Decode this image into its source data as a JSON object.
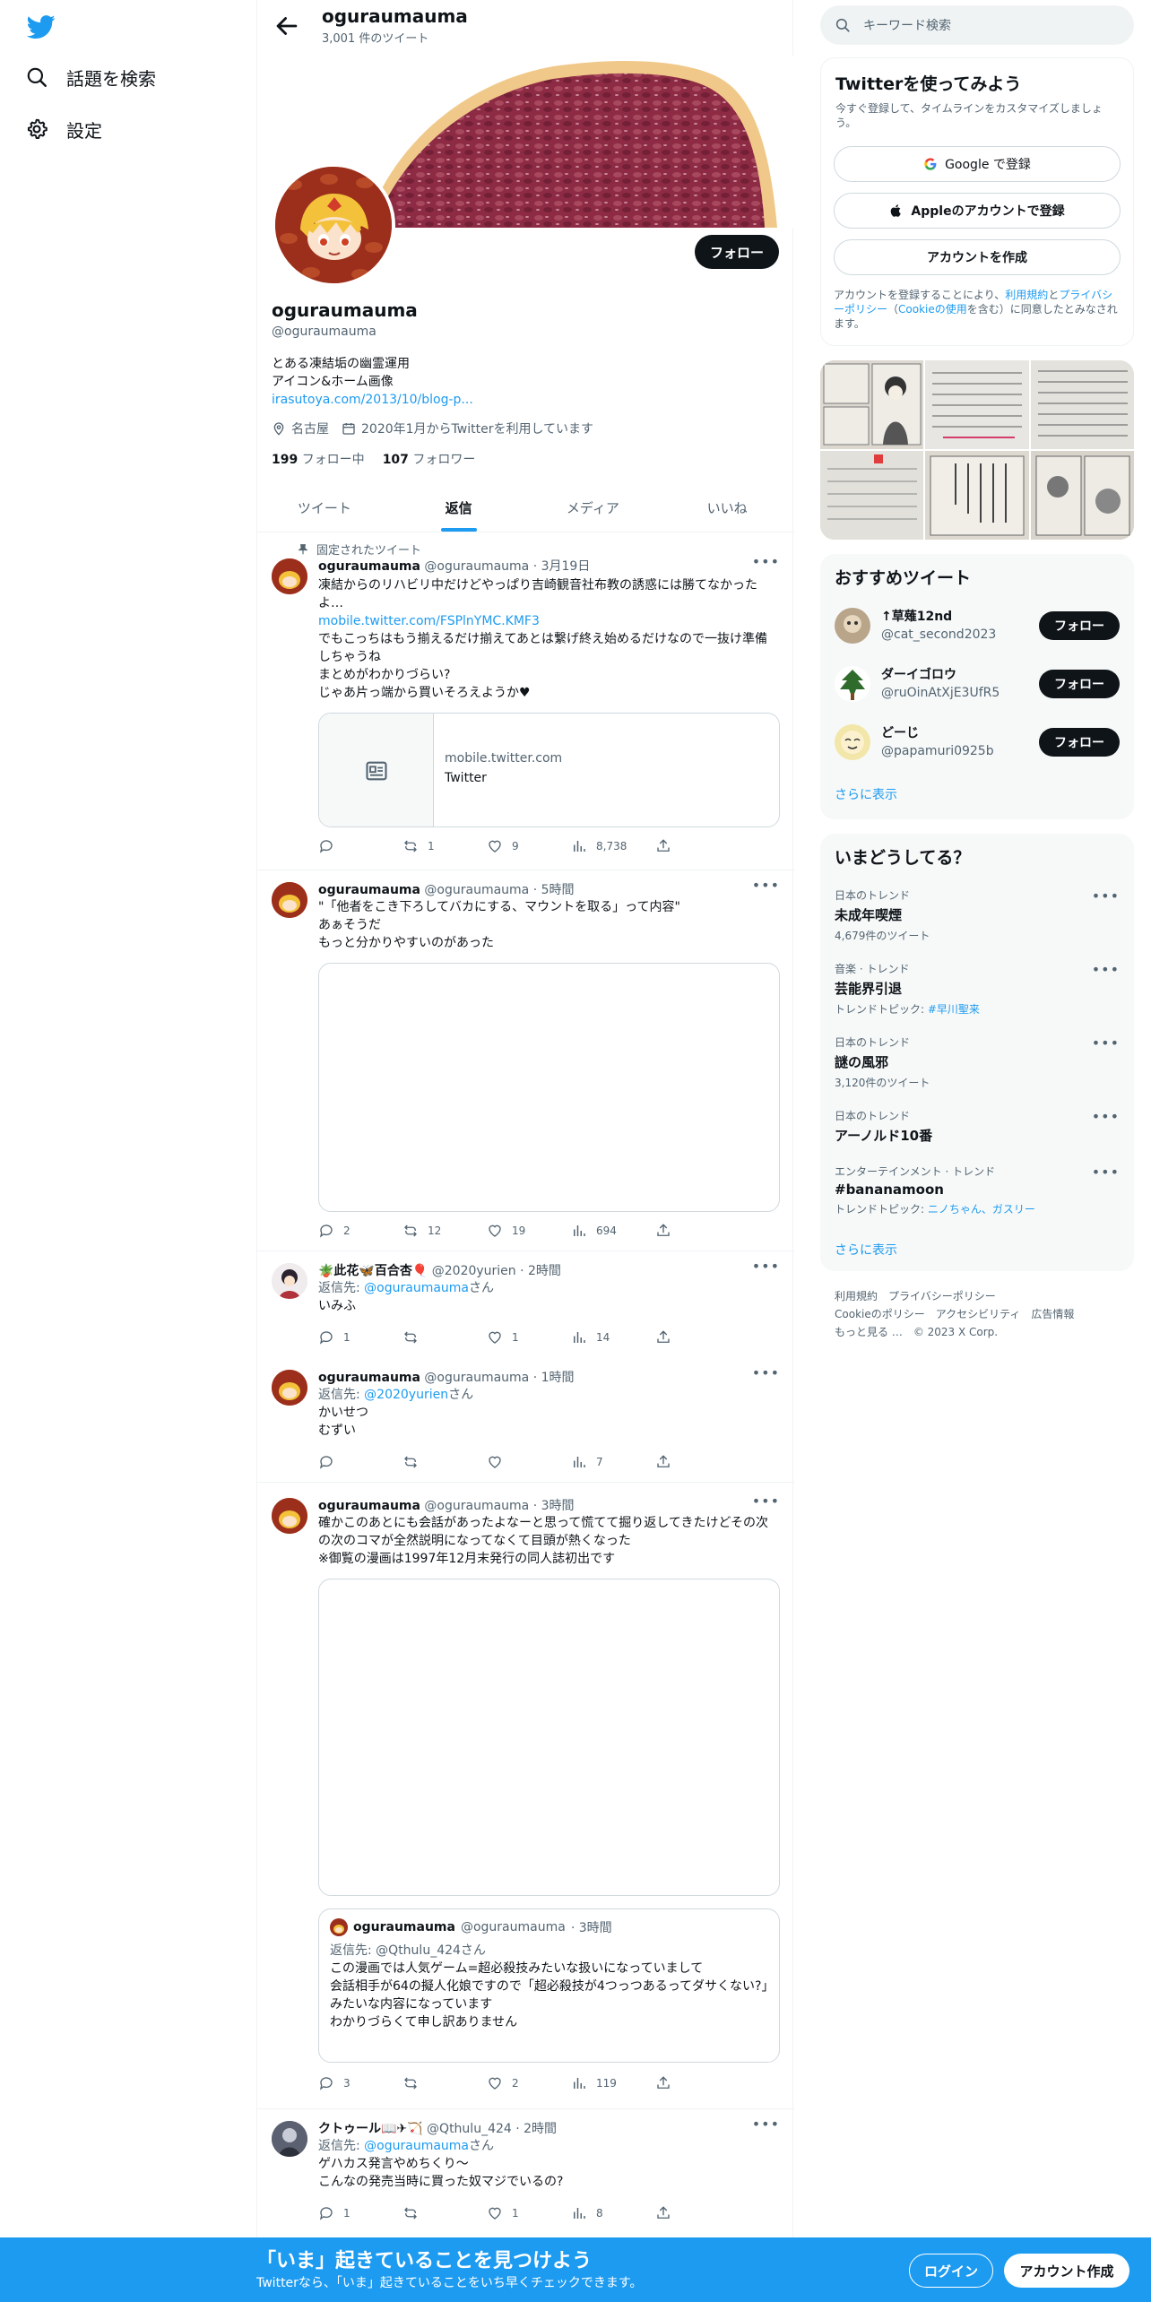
{
  "nav": {
    "explore_label": "話題を検索",
    "settings_label": "設定"
  },
  "header": {
    "name": "oguraumauma",
    "tweet_count": "3,001 件のツイート"
  },
  "profile": {
    "follow_label": "フォロー",
    "name": "oguraumauma",
    "handle": "@oguraumauma",
    "bio_line1": "とある凍結垢の幽霊運用",
    "bio_line2": "アイコン&ホーム画像",
    "bio_link": "irasutoya.com/2013/10/blog-p...",
    "location": "名古屋",
    "joined": "2020年1月からTwitterを利用しています",
    "following_count": "199",
    "following_label": "フォロー中",
    "followers_count": "107",
    "followers_label": "フォロワー"
  },
  "tabs": [
    {
      "label": "ツイート"
    },
    {
      "label": "返信"
    },
    {
      "label": "メディア"
    },
    {
      "label": "いいね"
    }
  ],
  "tweets": [
    {
      "pinned_label": "固定されたツイート",
      "name": "oguraumauma",
      "handle": "@oguraumauma",
      "time": "· 3月19日",
      "line1": "凍結からのリハビリ中だけどやっぱり吉崎観音社布教の誘惑には勝てなかったよ…",
      "link": "mobile.twitter.com/FSPlnYMC.KMF3",
      "line2": "でもこっちはもう揃えるだけ揃えてあとは繋げ終え始めるだけなので一抜け準備しちゃうね",
      "line3": "まとめがわかりづらい?",
      "line4": "じゃあ片っ端から買いそろえようか♥",
      "card_domain": "mobile.twitter.com",
      "card_title": "Twitter",
      "replies": "",
      "retweets": "1",
      "likes": "9",
      "views": "8,738"
    },
    {
      "name": "oguraumauma",
      "handle": "@oguraumauma",
      "time": "· 5時間",
      "line1": "\"「他者をこき下ろしてバカにする、マウントを取る」って内容\"",
      "line2": "あぁそうだ",
      "line3": "もっと分かりやすいのがあった",
      "replies": "2",
      "retweets": "12",
      "likes": "19",
      "views": "694"
    },
    {
      "name": "🪴此花🦋百合杏🎈",
      "handle": "@2020yurien",
      "time": "· 2時間",
      "reply_prefix": "返信先: ",
      "reply_to": "@oguraumauma",
      "reply_suffix": "さん",
      "line1": "いみふ",
      "replies": "1",
      "retweets": "",
      "likes": "1",
      "views": "14"
    },
    {
      "name": "oguraumauma",
      "handle": "@oguraumauma",
      "time": "· 1時間",
      "reply_prefix": "返信先: ",
      "reply_to": "@2020yurien",
      "reply_suffix": "さん",
      "line1": "かいせつ",
      "line2": "むずい",
      "replies": "",
      "retweets": "",
      "likes": "",
      "views": "7"
    },
    {
      "name": "oguraumauma",
      "handle": "@oguraumauma",
      "time": "· 3時間",
      "line1": "確かこのあとにも会話があったよなーと思って慌てて掘り返してきたけどその次の次のコマが全然説明になってなくて目頭が熱くなった",
      "line2": "※御覧の漫画は1997年12月末発行の同人誌初出です",
      "quote": {
        "name": "oguraumauma",
        "handle": "@oguraumauma",
        "time": "· 3時間",
        "reply_prefix": "返信先: ",
        "reply_to": "@Qthulu_424",
        "reply_suffix": "さん",
        "line1": "この漫画では人気ゲーム=超必殺技みたいな扱いになっていまして",
        "line2": "会話相手が64の擬人化娘ですので「超必殺技が4つっつあるってダサくない?」",
        "line3": "みたいな内容になっています",
        "line4": "わかりづらくて申し訳ありません"
      },
      "replies": "3",
      "retweets": "",
      "likes": "2",
      "views": "119"
    },
    {
      "name": "クトゥール📖✈🏹",
      "handle": "@Qthulu_424",
      "time": "· 2時間",
      "reply_prefix": "返信先: ",
      "reply_to": "@oguraumauma",
      "reply_suffix": "さん",
      "line1": "ゲハカス発言やめちくり〜",
      "line2": "こんなの発売当時に買った奴マジでいるの?",
      "replies": "1",
      "retweets": "",
      "likes": "1",
      "views": "8"
    }
  ],
  "right": {
    "search_placeholder": "キーワード検索",
    "signup_title": "Twitterを使ってみよう",
    "signup_sub": "今すぐ登録して、タイムラインをカスタマイズしましょう。",
    "google_btn": "Google で登録",
    "apple_btn": "Appleのアカウントで登録",
    "create_btn": "アカウントを作成",
    "legal_1": "アカウントを登録することにより、",
    "legal_terms": "利用規約",
    "legal_2": "と",
    "legal_privacy": "プライバシーポリシー",
    "legal_3": "（",
    "legal_cookie": "Cookieの使用",
    "legal_4": "を含む）に同意したとみなされます。",
    "rec_title": "おすすめツイート",
    "rec_users": [
      {
        "name": "↑草薙12nd",
        "handle": "@cat_second2023",
        "follow": "フォロー"
      },
      {
        "name": "ダーイゴロウ",
        "handle": "@ruOinAtXjE3UfR5",
        "follow": "フォロー"
      },
      {
        "name": "どーじ",
        "handle": "@papamuri0925b",
        "follow": "フォロー"
      }
    ],
    "show_more": "さらに表示",
    "trend_title": "いまどうしてる？",
    "trends": [
      {
        "cat": "日本のトレンド",
        "name": "未成年喫煙",
        "extra": "4,679件のツイート"
      },
      {
        "cat": "音楽 · トレンド",
        "name": "芸能界引退",
        "extra_prefix": "トレンドトピック: ",
        "extra_link": "#早川聖来"
      },
      {
        "cat": "日本のトレンド",
        "name": "謎の風邪",
        "extra": "3,120件のツイート"
      },
      {
        "cat": "日本のトレンド",
        "name": "アーノルド10番",
        "extra": ""
      },
      {
        "cat": "エンターテインメント · トレンド",
        "name": "#bananamoon",
        "extra_prefix": "トレンドトピック: ",
        "extra_link": "ニノちゃん、ガスリー"
      }
    ],
    "trend_more": "さらに表示",
    "footer": [
      "利用規約",
      "プライバシーポリシー",
      "Cookieのポリシー",
      "アクセシビリティ",
      "広告情報",
      "もっと見る …",
      "© 2023 X Corp."
    ]
  },
  "bottombar": {
    "title": "「いま」起きていることを見つけよう",
    "sub": "Twitterなら、「いま」起きていることをいち早くチェックできます。",
    "login": "ログイン",
    "signup": "アカウント作成"
  },
  "colors": {
    "accent": "#1d9bf0",
    "text": "#0f1419",
    "muted": "#536471"
  }
}
